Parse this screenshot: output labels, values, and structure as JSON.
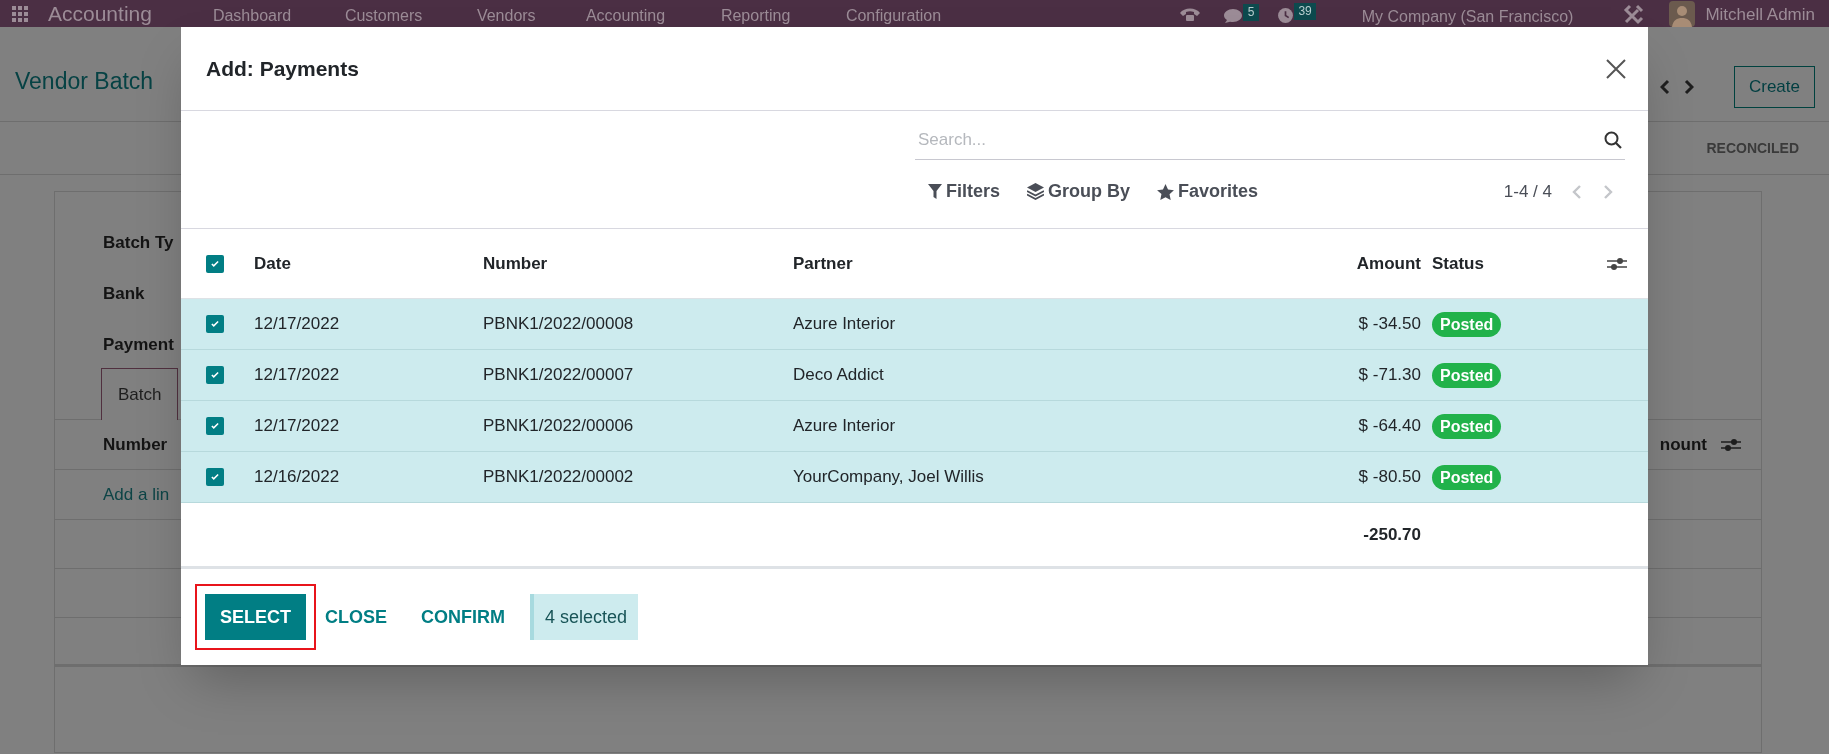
{
  "navbar": {
    "app": "Accounting",
    "menu": [
      "Dashboard",
      "Customers",
      "Vendors",
      "Accounting",
      "Reporting",
      "Configuration"
    ],
    "chat_count": "5",
    "activity_count": "39",
    "company": "My Company (San Francisco)",
    "user": "Mitchell Admin"
  },
  "background_form": {
    "title": "Vendor Batch",
    "create_button": "Create",
    "status_steps": [
      "RECONCILED"
    ],
    "fields": [
      "Batch Ty",
      "Bank",
      "Payment"
    ],
    "tab": "Batch",
    "list_columns": [
      "Number",
      "nount"
    ],
    "add_line": "Add a lin"
  },
  "dialog": {
    "title": "Add: Payments",
    "search": {
      "placeholder": "Search..."
    },
    "search_options": [
      {
        "kind": "filter",
        "label": "Filters"
      },
      {
        "kind": "group",
        "label": "Group By"
      },
      {
        "kind": "favorite",
        "label": "Favorites"
      }
    ],
    "pager": "1-4 / 4",
    "columns": [
      "Date",
      "Number",
      "Partner",
      "Amount",
      "Status"
    ],
    "all_checked": true,
    "rows": [
      {
        "date": "12/17/2022",
        "number": "PBNK1/2022/00008",
        "partner": "Azure Interior",
        "amount": "$ -34.50",
        "status": "Posted",
        "checked": true
      },
      {
        "date": "12/17/2022",
        "number": "PBNK1/2022/00007",
        "partner": "Deco Addict",
        "amount": "$ -71.30",
        "status": "Posted",
        "checked": true
      },
      {
        "date": "12/17/2022",
        "number": "PBNK1/2022/00006",
        "partner": "Azure Interior",
        "amount": "$ -64.40",
        "status": "Posted",
        "checked": true
      },
      {
        "date": "12/16/2022",
        "number": "PBNK1/2022/00002",
        "partner": "YourCompany, Joel Willis",
        "amount": "$ -80.50",
        "status": "Posted",
        "checked": true
      }
    ],
    "total": "-250.70",
    "buttons": [
      {
        "label": "SELECT",
        "kind": "primary",
        "highlighted": true
      },
      {
        "label": "CLOSE",
        "kind": "link",
        "highlighted": false
      },
      {
        "label": "CONFIRM",
        "kind": "link",
        "highlighted": false
      }
    ],
    "selection_count": "4 selected"
  }
}
